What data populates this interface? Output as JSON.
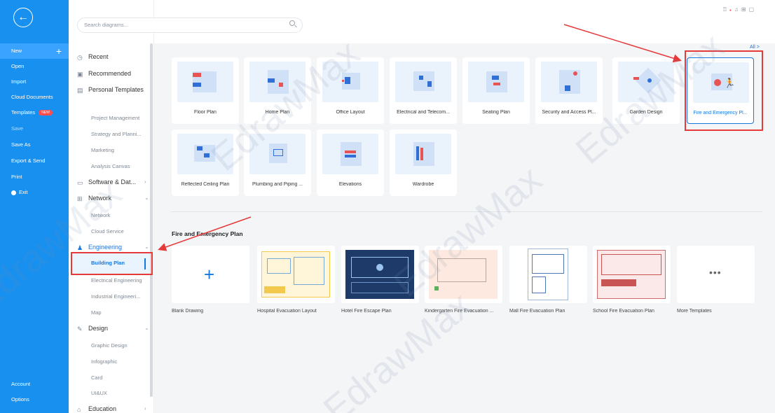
{
  "sidebar": {
    "items": {
      "new": "New",
      "open": "Open",
      "import": "Import",
      "cloud": "Cloud Documents",
      "templates": "Templates",
      "templates_badge": "NEW",
      "save": "Save",
      "save_as": "Save As",
      "export": "Export & Send",
      "print": "Print",
      "exit": "Exit",
      "account": "Account",
      "options": "Options"
    }
  },
  "search": {
    "placeholder": "Search diagrams..."
  },
  "panel": {
    "recent": "Recent",
    "recommended": "Recommended",
    "personal": "Personal Templates",
    "project_mgmt": "Project Management",
    "strategy": "Strategy and Planni...",
    "marketing": "Marketing",
    "analysis": "Analysis Canvas",
    "software": "Software & Dat...",
    "network": "Network",
    "network_sub": "Network",
    "cloud_service": "Cloud Service",
    "engineering": "Engineering",
    "building_plan": "Building Plan",
    "electrical": "Electrical Engineering",
    "industrial": "Industrial Engineeri...",
    "map": "Map",
    "design": "Design",
    "graphic": "Graphic Design",
    "infographic": "Infographic",
    "card": "Card",
    "uiux": "UI&UX",
    "education": "Education"
  },
  "main": {
    "all_link": "All >",
    "tiles": [
      "Floor Plan",
      "Home Plan",
      "Office Layout",
      "Electrical and Telecom...",
      "Seating Plan",
      "Security and Access Pl...",
      "Garden Design",
      "Fire and Emergency Pl...",
      "Reflected Ceiling Plan",
      "Plumbing and Piping ...",
      "Elevations",
      "Wardrobe"
    ],
    "section_title": "Fire and Emergency Plan",
    "templates": [
      "Blank Drawing",
      "Hospital Evacuation Layout",
      "Hotel Fire Escape Plan",
      "Kindergarten Fire Evacuation ...",
      "Mall Fire Evacuation Plan",
      "School Fire Evacuation Plan",
      "More Templates"
    ]
  },
  "watermark": "EdrawMax",
  "colors": {
    "sidebar": "#1890f0",
    "accent": "#1677e0",
    "annotation": "#e63a3a"
  }
}
